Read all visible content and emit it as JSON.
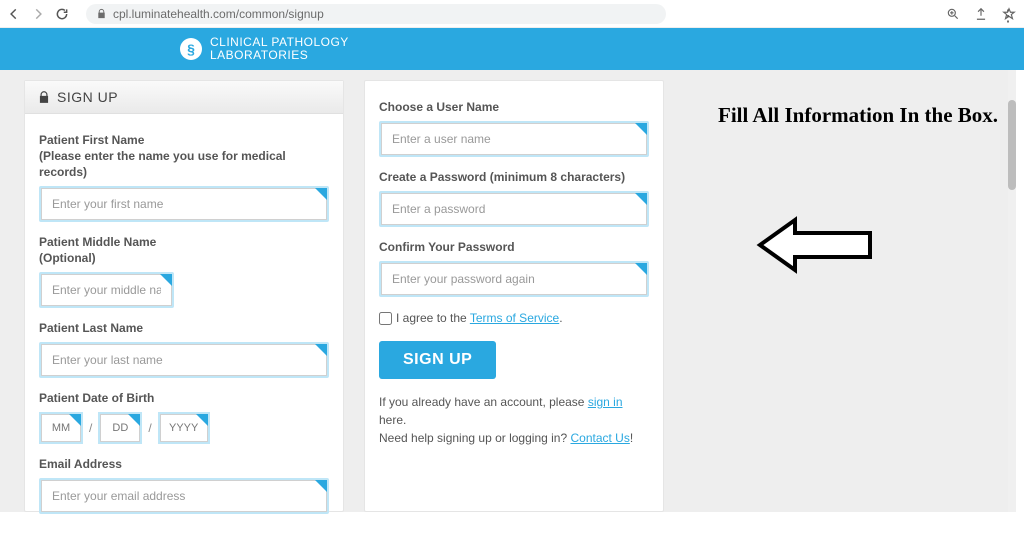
{
  "browser": {
    "url": "cpl.luminatehealth.com/common/signup"
  },
  "brand": {
    "line1": "CLINICAL PATHOLOGY",
    "line2": "LABORATORIES"
  },
  "header": {
    "title": "SIGN UP"
  },
  "left": {
    "first_label": "Patient First Name",
    "first_sub": "(Please enter the name you use for medical records)",
    "first_ph": "Enter your first name",
    "middle_label": "Patient Middle Name",
    "middle_sub": "(Optional)",
    "middle_ph": "Enter your middle name",
    "last_label": "Patient Last Name",
    "last_ph": "Enter your last name",
    "dob_label": "Patient Date of Birth",
    "mm_ph": "MM",
    "dd_ph": "DD",
    "yyyy_ph": "YYYY",
    "slash": "/",
    "email_label": "Email Address",
    "email_ph": "Enter your email address"
  },
  "right": {
    "user_label": "Choose a User Name",
    "user_ph": "Enter a user name",
    "pass_label": "Create a Password (minimum 8 characters)",
    "pass_ph": "Enter a password",
    "confirm_label": "Confirm Your Password",
    "confirm_ph": "Enter your password again",
    "agree_pre": "I agree to the ",
    "agree_link": "Terms of Service",
    "agree_post": ".",
    "button": "SIGN UP",
    "help1_a": "If you already have an account, please ",
    "help1_link": "sign in",
    "help1_b": " here.",
    "help2_a": "Need help signing up or logging in? ",
    "help2_link": "Contact Us",
    "help2_b": "!"
  },
  "annotation": {
    "title": "Fill All Information In the Box."
  }
}
